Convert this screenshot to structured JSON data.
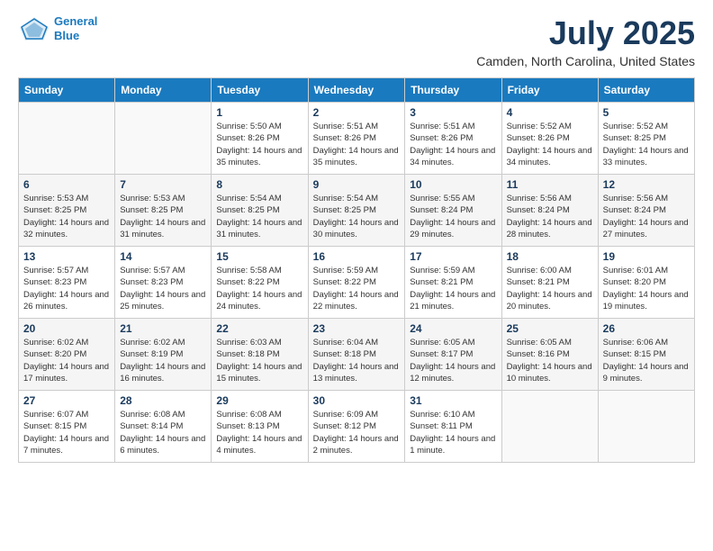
{
  "logo": {
    "line1": "General",
    "line2": "Blue"
  },
  "title": "July 2025",
  "location": "Camden, North Carolina, United States",
  "days_of_week": [
    "Sunday",
    "Monday",
    "Tuesday",
    "Wednesday",
    "Thursday",
    "Friday",
    "Saturday"
  ],
  "weeks": [
    [
      {
        "day": "",
        "info": ""
      },
      {
        "day": "",
        "info": ""
      },
      {
        "day": "1",
        "info": "Sunrise: 5:50 AM\nSunset: 8:26 PM\nDaylight: 14 hours and 35 minutes."
      },
      {
        "day": "2",
        "info": "Sunrise: 5:51 AM\nSunset: 8:26 PM\nDaylight: 14 hours and 35 minutes."
      },
      {
        "day": "3",
        "info": "Sunrise: 5:51 AM\nSunset: 8:26 PM\nDaylight: 14 hours and 34 minutes."
      },
      {
        "day": "4",
        "info": "Sunrise: 5:52 AM\nSunset: 8:26 PM\nDaylight: 14 hours and 34 minutes."
      },
      {
        "day": "5",
        "info": "Sunrise: 5:52 AM\nSunset: 8:25 PM\nDaylight: 14 hours and 33 minutes."
      }
    ],
    [
      {
        "day": "6",
        "info": "Sunrise: 5:53 AM\nSunset: 8:25 PM\nDaylight: 14 hours and 32 minutes."
      },
      {
        "day": "7",
        "info": "Sunrise: 5:53 AM\nSunset: 8:25 PM\nDaylight: 14 hours and 31 minutes."
      },
      {
        "day": "8",
        "info": "Sunrise: 5:54 AM\nSunset: 8:25 PM\nDaylight: 14 hours and 31 minutes."
      },
      {
        "day": "9",
        "info": "Sunrise: 5:54 AM\nSunset: 8:25 PM\nDaylight: 14 hours and 30 minutes."
      },
      {
        "day": "10",
        "info": "Sunrise: 5:55 AM\nSunset: 8:24 PM\nDaylight: 14 hours and 29 minutes."
      },
      {
        "day": "11",
        "info": "Sunrise: 5:56 AM\nSunset: 8:24 PM\nDaylight: 14 hours and 28 minutes."
      },
      {
        "day": "12",
        "info": "Sunrise: 5:56 AM\nSunset: 8:24 PM\nDaylight: 14 hours and 27 minutes."
      }
    ],
    [
      {
        "day": "13",
        "info": "Sunrise: 5:57 AM\nSunset: 8:23 PM\nDaylight: 14 hours and 26 minutes."
      },
      {
        "day": "14",
        "info": "Sunrise: 5:57 AM\nSunset: 8:23 PM\nDaylight: 14 hours and 25 minutes."
      },
      {
        "day": "15",
        "info": "Sunrise: 5:58 AM\nSunset: 8:22 PM\nDaylight: 14 hours and 24 minutes."
      },
      {
        "day": "16",
        "info": "Sunrise: 5:59 AM\nSunset: 8:22 PM\nDaylight: 14 hours and 22 minutes."
      },
      {
        "day": "17",
        "info": "Sunrise: 5:59 AM\nSunset: 8:21 PM\nDaylight: 14 hours and 21 minutes."
      },
      {
        "day": "18",
        "info": "Sunrise: 6:00 AM\nSunset: 8:21 PM\nDaylight: 14 hours and 20 minutes."
      },
      {
        "day": "19",
        "info": "Sunrise: 6:01 AM\nSunset: 8:20 PM\nDaylight: 14 hours and 19 minutes."
      }
    ],
    [
      {
        "day": "20",
        "info": "Sunrise: 6:02 AM\nSunset: 8:20 PM\nDaylight: 14 hours and 17 minutes."
      },
      {
        "day": "21",
        "info": "Sunrise: 6:02 AM\nSunset: 8:19 PM\nDaylight: 14 hours and 16 minutes."
      },
      {
        "day": "22",
        "info": "Sunrise: 6:03 AM\nSunset: 8:18 PM\nDaylight: 14 hours and 15 minutes."
      },
      {
        "day": "23",
        "info": "Sunrise: 6:04 AM\nSunset: 8:18 PM\nDaylight: 14 hours and 13 minutes."
      },
      {
        "day": "24",
        "info": "Sunrise: 6:05 AM\nSunset: 8:17 PM\nDaylight: 14 hours and 12 minutes."
      },
      {
        "day": "25",
        "info": "Sunrise: 6:05 AM\nSunset: 8:16 PM\nDaylight: 14 hours and 10 minutes."
      },
      {
        "day": "26",
        "info": "Sunrise: 6:06 AM\nSunset: 8:15 PM\nDaylight: 14 hours and 9 minutes."
      }
    ],
    [
      {
        "day": "27",
        "info": "Sunrise: 6:07 AM\nSunset: 8:15 PM\nDaylight: 14 hours and 7 minutes."
      },
      {
        "day": "28",
        "info": "Sunrise: 6:08 AM\nSunset: 8:14 PM\nDaylight: 14 hours and 6 minutes."
      },
      {
        "day": "29",
        "info": "Sunrise: 6:08 AM\nSunset: 8:13 PM\nDaylight: 14 hours and 4 minutes."
      },
      {
        "day": "30",
        "info": "Sunrise: 6:09 AM\nSunset: 8:12 PM\nDaylight: 14 hours and 2 minutes."
      },
      {
        "day": "31",
        "info": "Sunrise: 6:10 AM\nSunset: 8:11 PM\nDaylight: 14 hours and 1 minute."
      },
      {
        "day": "",
        "info": ""
      },
      {
        "day": "",
        "info": ""
      }
    ]
  ]
}
